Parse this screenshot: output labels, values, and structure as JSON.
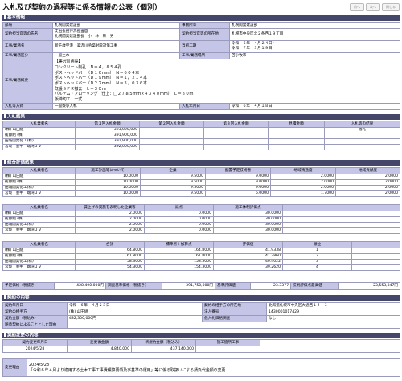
{
  "header": {
    "title": "入札及び契約の過程等に係る情報の公表（個別）",
    "nav": [
      "前へ",
      "次へ",
      "閉じる"
    ]
  },
  "basic": {
    "section": "基本情報",
    "rows": [
      [
        "部局",
        "札幌開発建設部",
        "事務所等",
        "札幌開発建設部"
      ],
      [
        "契約担当官等の氏名",
        "支出負担行為担当官\n札幌開発建設部長　小　林　幹　男",
        "契約担当官等の所在地",
        "札幌市中央区北２条西１９丁目"
      ],
      [
        "工事/業務名",
        "新千歳空港　美沢川函渠耐震対策工事",
        "当初工期",
        "令和　６年　４月２４日～\n令和　７年　３月１９日"
      ],
      [
        "工事/業務区分",
        "一般土木",
        "工事/業務場所",
        "苫小牧市"
      ],
      [
        "工事/業務概要",
        "【美沢川函渠】\nコンクリート削孔　Ｎ＝４，８５４孔\nポストヘッドバー（Ｄ１６ｍｍ）　Ｎ＝６０４本\nポストヘッドバー（Ｄ１９ｍｍ）　Ｎ＝１，２１４本\nポストヘッドバー（Ｄ２２ｍｍ）　Ｎ＝３，０３６本\n既設ＳＰＲ撤去　Ｌ＝３０ｍ\nパルテム・フローリング（仕上：□２７８５ｍｍ×４３４０ｍｍ）　Ｌ＝３０ｍ\n仮締切工　一式",
        "",
        ""
      ],
      [
        "入札等方式",
        "一般競争入札",
        "入札年月日",
        "令和　６年　４月１８日"
      ]
    ]
  },
  "bid": {
    "section": "入札結果",
    "headers": [
      "入札業者名",
      "第１回入札金額",
      "第２回入札金額",
      "第３回入札金額",
      "見積金額",
      "入札等の結果"
    ],
    "rows": [
      [
        "(株) 山田組",
        "393,000,000",
        "",
        "",
        "",
        "落札"
      ],
      [
        "衛藤組 (株)",
        "391,900,000",
        "",
        "",
        "",
        ""
      ],
      [
        "田城開発化工(株)",
        "391,900,000",
        "",
        "",
        "",
        ""
      ],
      [
        "宮坂　豊中　端湾ＪＶ",
        "392,000,000",
        "",
        "",
        "",
        ""
      ]
    ]
  },
  "eval": {
    "section": "総合評価結果",
    "table1": {
      "headers": [
        "入札業者名",
        "施工計画等について",
        "企業",
        "配置予定技術者",
        "地域精通度",
        "地域貢献度"
      ],
      "rows": [
        [
          "(株) 山田組",
          "10.0000",
          "9.5000",
          "9.0000",
          "2.0000",
          "2.0000"
        ],
        [
          "衛藤組 (株)",
          "10.0000",
          "9.5000",
          "9.0000",
          "2.0000",
          "2.0000"
        ],
        [
          "田城開発化工(株)",
          "10.0000",
          "9.5000",
          "9.0000",
          "2.0000",
          "2.0000"
        ],
        [
          "宮坂　豊中　端湾ＪＶ",
          "10.0000",
          "9.5000",
          "6.0000",
          "1.7000",
          "2.0000"
        ]
      ]
    },
    "table2": {
      "headers": [
        "入札業者名",
        "賃上げの実施を表明した企業等",
        "減点",
        "施工体制評価点"
      ],
      "rows": [
        [
          "(株) 山田組",
          "2.0000",
          "0.0000",
          "30.0000"
        ],
        [
          "衛藤組 (株)",
          "2.0000",
          "0.0000",
          "30.0000"
        ],
        [
          "田城開発化工(株)",
          "2.0000",
          "0.0000",
          "30.0000"
        ],
        [
          "宮坂　豊中　端湾ＪＶ",
          "2.0000",
          "0.0000",
          "30.0000"
        ]
      ]
    },
    "table3": {
      "headers": [
        "入札業者名",
        "合計",
        "標準点＋加算点",
        "評価値",
        "順位"
      ],
      "rows": [
        [
          "(株) 山田組",
          "64.8000",
          "164.8000",
          "41.9338",
          "1"
        ],
        [
          "衛藤組 (株)",
          "61.8000",
          "161.8000",
          "41.2860",
          "2"
        ],
        [
          "田城開発化工(株)",
          "58.3000",
          "158.3000",
          "40.4022",
          "3"
        ],
        [
          "宮坂　豊中　端湾ＪＶ",
          "54.3000",
          "154.3000",
          "39.2620",
          "4"
        ]
      ]
    },
    "summary": [
      "予定価格（税抜き）",
      "428,490,000円",
      "調査基準価格（税抜き）",
      "391,750,000円",
      "基準評価値",
      "23.3377",
      "技術評価点最高値",
      "23,553,047円"
    ]
  },
  "contract": {
    "section": "契約の内容",
    "rows": [
      [
        "契約年月日",
        "令和　６年　４月２３日",
        "契約の相手方の所在地",
        "北海道札幌市中央区大通西１４－１"
      ],
      [
        "契約の相手方",
        "(株) 山田組",
        "法人番号",
        "1430001017429"
      ],
      [
        "契約金額（税込み）",
        "432,300,000円",
        "低入札価格調査",
        "なし"
      ],
      [
        "随意契約によることとした理由",
        "",
        "",
        ""
      ]
    ]
  },
  "change": {
    "section": "契約変更の内容",
    "headers": [
      "契約変更年月日",
      "変更後金額",
      "新規約金額（税込み）",
      "施工箇所工事"
    ],
    "row": [
      "2024/5/28",
      "4,840,000",
      "437,140,000",
      ""
    ],
    "reason_label": "変更理由",
    "reason": "2024/5/28\n「令和６年４月より適用する土木工事工事費積算要領及び基準の運用」等に係る取扱いによる請負代金額の変更"
  }
}
